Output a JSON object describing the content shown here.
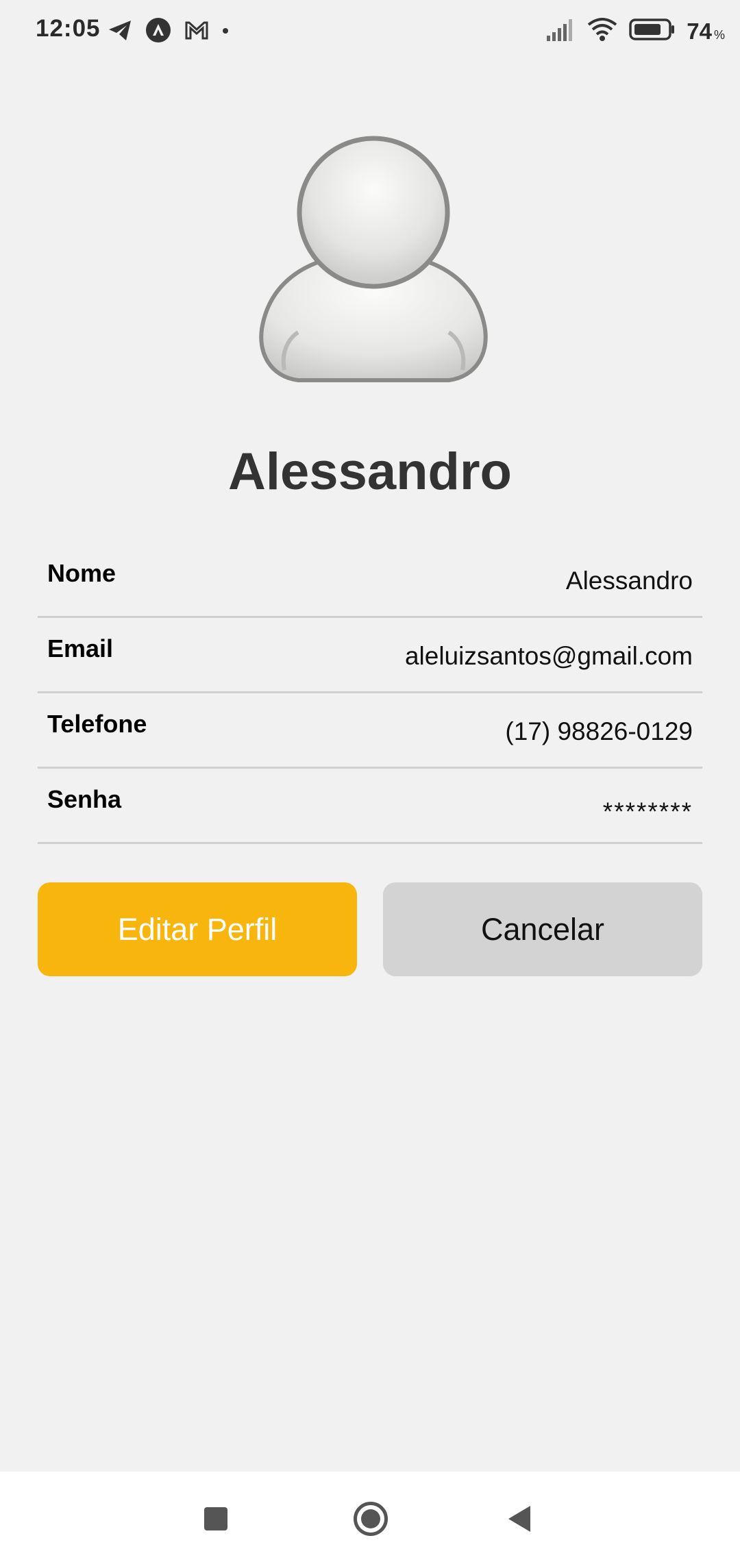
{
  "status_bar": {
    "time": "12:05",
    "left_icons": [
      "telegram-icon",
      "app-icon",
      "gmail-icon",
      "dot-icon"
    ],
    "right_icons": [
      "signal-icon",
      "wifi-icon",
      "battery-icon"
    ],
    "battery_percent": "74",
    "battery_unit": "%"
  },
  "profile": {
    "avatar_icon": "user-avatar-icon",
    "name": "Alessandro"
  },
  "fields": {
    "nome": {
      "label": "Nome",
      "value": "Alessandro"
    },
    "email": {
      "label": "Email",
      "value": "aleluizsantos@gmail.com"
    },
    "telefone": {
      "label": "Telefone",
      "value": "(17) 98826-0129"
    },
    "senha": {
      "label": "Senha",
      "value": "********"
    }
  },
  "actions": {
    "edit_label": "Editar Perfil",
    "cancel_label": "Cancelar"
  },
  "colors": {
    "background": "#f1f1f1",
    "accent": "#f7b50d",
    "secondary_button": "#d3d3d3",
    "divider": "#cfcfcf"
  },
  "nav_bar": {
    "icons": [
      "recents-icon",
      "home-icon",
      "back-icon"
    ]
  }
}
